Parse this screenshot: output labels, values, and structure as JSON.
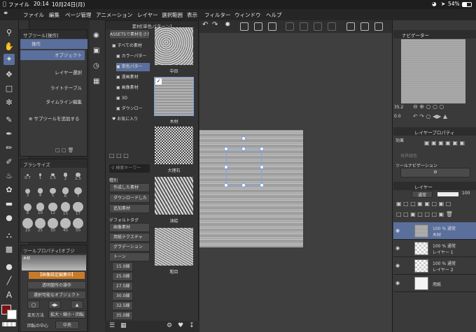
{
  "status": {
    "time": "20:14",
    "date": "10月24日(月)",
    "battery": "54%",
    "app_icon": "apple-icon"
  },
  "menu": [
    "ファイル",
    "編集",
    "ページ管理",
    "アニメーション",
    "レイヤー",
    "選択範囲",
    "表示",
    "フィルター",
    "ウィンドウ",
    "ヘルプ"
  ],
  "subtool": {
    "header": "サブツール[操作]",
    "group": "操作",
    "items": [
      "オブジェクト",
      "レイヤー選択",
      "ライトテーブル",
      "タイムライン編集"
    ],
    "add": "サブツールを追加する"
  },
  "brush": {
    "header": "ブラシサイズ",
    "sizes": [
      "0.7",
      "1",
      "1.5",
      "2",
      "2.5",
      "3",
      "4",
      "5",
      "6",
      "7",
      "8",
      "10",
      "12",
      "15",
      "17",
      "20",
      "25",
      "30",
      "40",
      "50"
    ]
  },
  "toolprop": {
    "header": "ツールプロパティ[オブジ",
    "preview_title": "木材",
    "mode_label": "【画像設定編集中】",
    "op1": "透明箇所の操作",
    "op2": "選択可能なオブジェクト",
    "transform_method": "変形方法",
    "transform_value": "拡大・縮小・回転",
    "rotate_center": "回転の中心",
    "rotate_value": "中央"
  },
  "material": {
    "header": "素材[単色パターン]",
    "assets_button": "ASSETSで素材をさがす",
    "tree": [
      {
        "label": "すべての素材"
      },
      {
        "label": "カラーパター"
      },
      {
        "label": "単色パター",
        "selected": true
      },
      {
        "label": "漫画素材"
      },
      {
        "label": "画像素材"
      },
      {
        "label": "3D"
      },
      {
        "label": "ダウンロー"
      },
      {
        "label": "お気に入り"
      }
    ],
    "search_placeholder": "検索キーワー",
    "tag_title": "種別",
    "tags1": [
      "作成した素材",
      "ダウンロードした",
      "追加素材"
    ],
    "default_tag_title": "デフォルトタグ",
    "tags2": [
      "画像素材",
      "用紙テクスチャ",
      "グラデーション",
      "トーン",
      "15.0線",
      "25.0線",
      "27.5線",
      "30.0線",
      "32.5線",
      "35.0線"
    ],
    "thumbs": [
      "中目",
      "木材",
      "大理石",
      "油絵",
      "粗目"
    ]
  },
  "navigator": {
    "header": "ナビゲーター",
    "zoom": "35.2",
    "angle": "0.0"
  },
  "layerprop": {
    "header": "レイヤープロパティ",
    "effect": "効果",
    "border_color": "境界線色",
    "tool_nav": "ツールナビゲーション"
  },
  "layers": {
    "header": "レイヤー",
    "blend": "通常",
    "opacity": "100",
    "items": [
      {
        "pct": "100 % 通常",
        "name": "木材",
        "selected": true
      },
      {
        "pct": "100 % 通常",
        "name": "レイヤー 1"
      },
      {
        "pct": "100 % 通常",
        "name": "レイヤー 2"
      },
      {
        "pct": "",
        "name": "用紙"
      }
    ]
  },
  "colors": {
    "accent": "#5a6f9c",
    "main_color": "#7a1414",
    "sub_color": "#ffffff",
    "canvas_bg": "#3f3f3f"
  }
}
